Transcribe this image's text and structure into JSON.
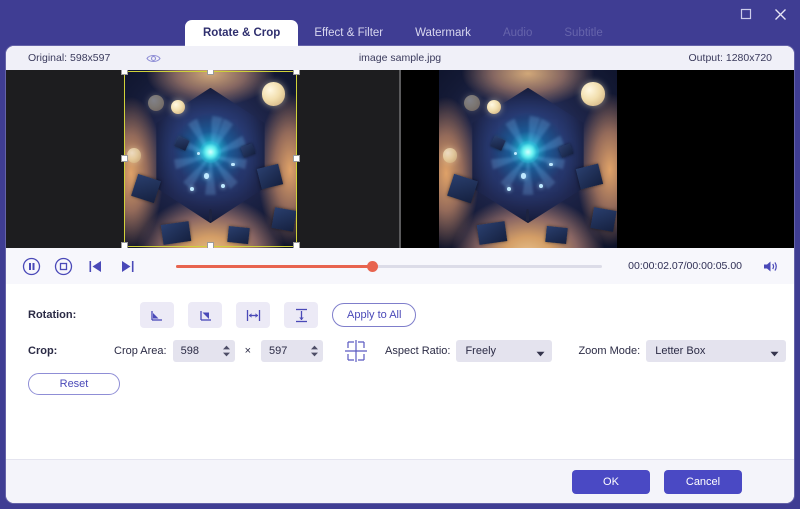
{
  "window": {
    "maximize_icon": "maximize-icon",
    "close_icon": "close-icon"
  },
  "tabs": [
    {
      "label": "Rotate & Crop",
      "state": "active"
    },
    {
      "label": "Effect & Filter",
      "state": "normal"
    },
    {
      "label": "Watermark",
      "state": "normal"
    },
    {
      "label": "Audio",
      "state": "disabled"
    },
    {
      "label": "Subtitle",
      "state": "disabled"
    }
  ],
  "info": {
    "original": "Original: 598x597",
    "eye_icon": "eye-icon",
    "filename": "image sample.jpg",
    "output": "Output: 1280x720"
  },
  "transport": {
    "pause_icon": "pause-circle-icon",
    "stop_icon": "stop-circle-icon",
    "prev_icon": "previous-frame-icon",
    "next_icon": "next-frame-icon",
    "timecode": "00:00:02.07/00:00:05.00",
    "volume_icon": "volume-icon",
    "progress_percent": 46
  },
  "rotation": {
    "label": "Rotation:",
    "buttons": [
      {
        "icon": "rotate-left-icon"
      },
      {
        "icon": "rotate-right-icon"
      },
      {
        "icon": "flip-horizontal-icon"
      },
      {
        "icon": "flip-vertical-icon"
      }
    ],
    "apply_to_all": "Apply to All"
  },
  "crop": {
    "label": "Crop:",
    "area_label": "Crop Area:",
    "width": "598",
    "times": "×",
    "height": "597",
    "target_icon": "crop-center-icon",
    "aspect_ratio_label": "Aspect Ratio:",
    "aspect_ratio_value": "Freely",
    "zoom_mode_label": "Zoom Mode:",
    "zoom_mode_value": "Letter Box",
    "reset": "Reset"
  },
  "footer": {
    "ok": "OK",
    "cancel": "Cancel"
  },
  "colors": {
    "titlebar": "#3f3d93",
    "accent": "#4a49c4",
    "crop_outline": "#cfd13a",
    "seek": "#e8644f",
    "panel": "#ffffff"
  }
}
